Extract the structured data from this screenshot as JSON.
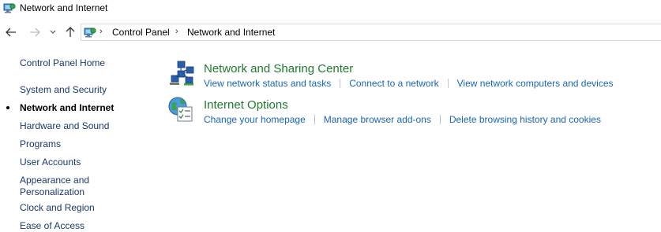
{
  "window": {
    "title": "Network and Internet"
  },
  "nav": {
    "breadcrumbs": [
      "Control Panel",
      "Network and Internet"
    ]
  },
  "sidebar": {
    "items": [
      {
        "label": "Control Panel Home"
      },
      {
        "label": "System and Security"
      },
      {
        "label": "Network and Internet",
        "current": true
      },
      {
        "label": "Hardware and Sound"
      },
      {
        "label": "Programs"
      },
      {
        "label": "User Accounts"
      },
      {
        "label": "Appearance and Personalization"
      },
      {
        "label": "Clock and Region"
      },
      {
        "label": "Ease of Access"
      }
    ]
  },
  "main": {
    "sections": [
      {
        "title": "Network and Sharing Center",
        "icon": "network-sharing-icon",
        "links": [
          "View network status and tasks",
          "Connect to a network",
          "View network computers and devices"
        ]
      },
      {
        "title": "Internet Options",
        "icon": "internet-options-icon",
        "links": [
          "Change your homepage",
          "Manage browser add-ons",
          "Delete browsing history and cookies"
        ]
      }
    ]
  },
  "colors": {
    "section_title": "#1e7b2e",
    "link": "#1a65b8",
    "sidebar_link": "#1a3a6b",
    "address_border": "#d9d9d9"
  }
}
